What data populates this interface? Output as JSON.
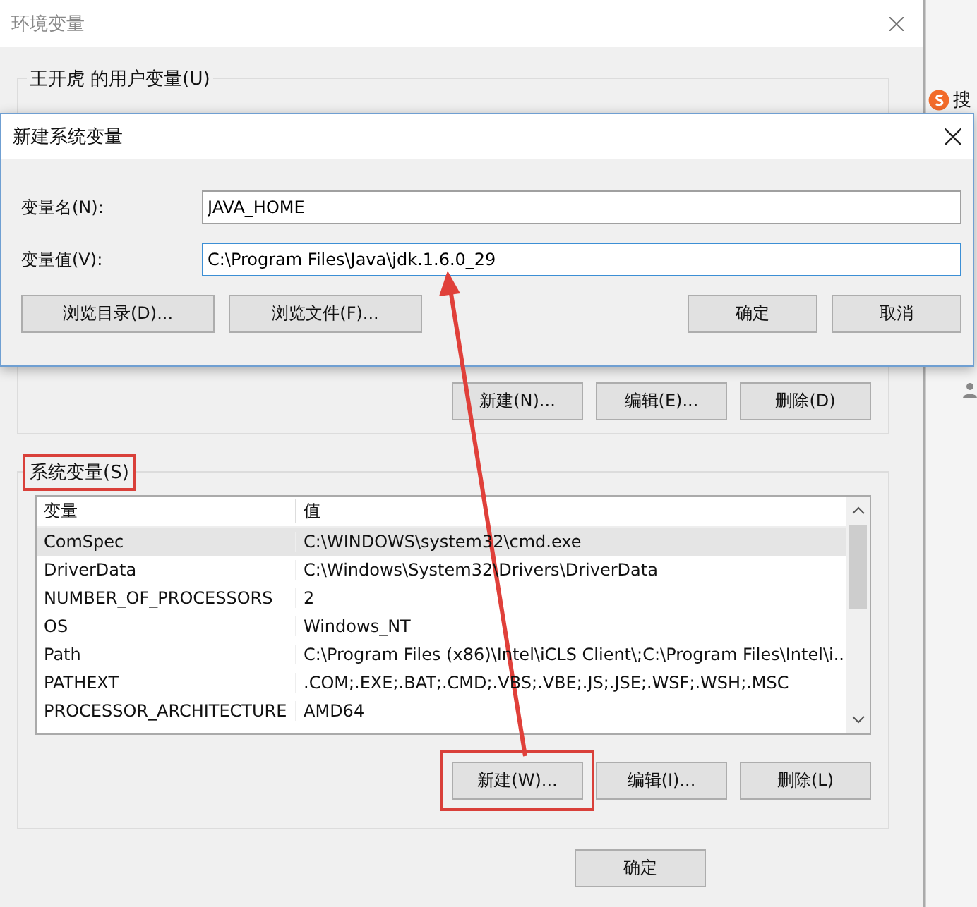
{
  "background": {
    "app_text": "搜"
  },
  "window": {
    "title": "环境变量",
    "user_group": {
      "label": "王开虎 的用户变量(U)",
      "buttons": [
        "新建(N)...",
        "编辑(E)...",
        "删除(D)"
      ]
    },
    "system_group": {
      "label": "系统变量(S)",
      "highlighted": true,
      "columns": [
        "变量",
        "值"
      ],
      "rows": [
        {
          "name": "ComSpec",
          "value": "C:\\WINDOWS\\system32\\cmd.exe",
          "selected": true
        },
        {
          "name": "DriverData",
          "value": "C:\\Windows\\System32\\Drivers\\DriverData",
          "selected": false
        },
        {
          "name": "NUMBER_OF_PROCESSORS",
          "value": "2",
          "selected": false
        },
        {
          "name": "OS",
          "value": "Windows_NT",
          "selected": false
        },
        {
          "name": "Path",
          "value": "C:\\Program Files (x86)\\Intel\\iCLS Client\\;C:\\Program Files\\Intel\\i...",
          "selected": false
        },
        {
          "name": "PATHEXT",
          "value": ".COM;.EXE;.BAT;.CMD;.VBS;.VBE;.JS;.JSE;.WSF;.WSH;.MSC",
          "selected": false
        },
        {
          "name": "PROCESSOR_ARCHITECTURE",
          "value": "AMD64",
          "selected": false
        }
      ],
      "buttons": [
        {
          "label": "新建(W)...",
          "highlighted": true
        },
        {
          "label": "编辑(I)...",
          "highlighted": false
        },
        {
          "label": "删除(L)",
          "highlighted": false
        }
      ]
    },
    "buttons": [
      "确定"
    ]
  },
  "dialog": {
    "title": "新建系统变量",
    "fields": [
      {
        "label": "变量名(N):",
        "value": "JAVA_HOME",
        "focused": false
      },
      {
        "label": "变量值(V):",
        "value": "C:\\Program Files\\Java\\jdk.1.6.0_29",
        "focused": true
      }
    ],
    "left_buttons": [
      "浏览目录(D)...",
      "浏览文件(F)..."
    ],
    "right_buttons": [
      "确定",
      "取消"
    ]
  }
}
